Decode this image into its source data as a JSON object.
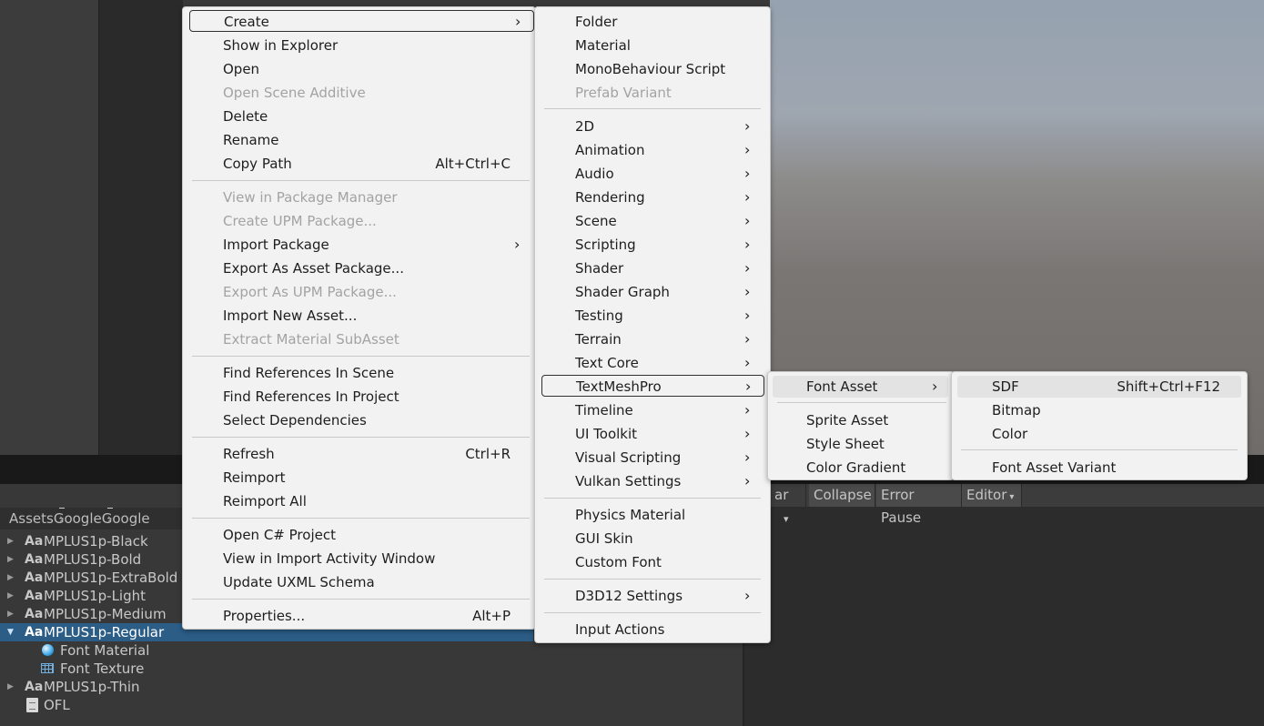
{
  "context_menu": {
    "items": [
      {
        "label": "Create",
        "arrow": "›"
      },
      {
        "label": "Show in Explorer"
      },
      {
        "label": "Open"
      },
      {
        "label": "Open Scene Additive",
        "disabled": true
      },
      {
        "label": "Delete"
      },
      {
        "label": "Rename"
      },
      {
        "label": "Copy Path",
        "shortcut": "Alt+Ctrl+C"
      },
      {
        "label": "View in Package Manager",
        "disabled": true
      },
      {
        "label": "Create UPM Package...",
        "disabled": true
      },
      {
        "label": "Import Package",
        "arrow": "›"
      },
      {
        "label": "Export As Asset Package..."
      },
      {
        "label": "Export As UPM Package...",
        "disabled": true
      },
      {
        "label": "Import New Asset..."
      },
      {
        "label": "Extract Material SubAsset",
        "disabled": true
      },
      {
        "label": "Find References In Scene"
      },
      {
        "label": "Find References In Project"
      },
      {
        "label": "Select Dependencies"
      },
      {
        "label": "Refresh",
        "shortcut": "Ctrl+R"
      },
      {
        "label": "Reimport"
      },
      {
        "label": "Reimport All"
      },
      {
        "label": "Open C# Project"
      },
      {
        "label": "View in Import Activity Window"
      },
      {
        "label": "Update UXML Schema"
      },
      {
        "label": "Properties...",
        "shortcut": "Alt+P"
      }
    ]
  },
  "create_submenu": {
    "items": [
      {
        "label": "Folder"
      },
      {
        "label": "Material"
      },
      {
        "label": "MonoBehaviour Script"
      },
      {
        "label": "Prefab Variant",
        "disabled": true
      },
      {
        "label": "2D",
        "arrow": "›"
      },
      {
        "label": "Animation",
        "arrow": "›"
      },
      {
        "label": "Audio",
        "arrow": "›"
      },
      {
        "label": "Rendering",
        "arrow": "›"
      },
      {
        "label": "Scene",
        "arrow": "›"
      },
      {
        "label": "Scripting",
        "arrow": "›"
      },
      {
        "label": "Shader",
        "arrow": "›"
      },
      {
        "label": "Shader Graph",
        "arrow": "›"
      },
      {
        "label": "Testing",
        "arrow": "›"
      },
      {
        "label": "Terrain",
        "arrow": "›"
      },
      {
        "label": "Text Core",
        "arrow": "›"
      },
      {
        "label": "TextMeshPro",
        "arrow": "›"
      },
      {
        "label": "Timeline",
        "arrow": "›"
      },
      {
        "label": "UI Toolkit",
        "arrow": "›"
      },
      {
        "label": "Visual Scripting",
        "arrow": "›"
      },
      {
        "label": "Vulkan Settings",
        "arrow": "›"
      },
      {
        "label": "Physics Material"
      },
      {
        "label": "GUI Skin"
      },
      {
        "label": "Custom Font"
      },
      {
        "label": "D3D12 Settings",
        "arrow": "›"
      },
      {
        "label": "Input Actions"
      }
    ]
  },
  "textmeshpro_submenu": {
    "items": [
      {
        "label": "Font Asset",
        "arrow": "›"
      },
      {
        "label": "Sprite Asset"
      },
      {
        "label": "Style Sheet"
      },
      {
        "label": "Color Gradient"
      }
    ]
  },
  "font_asset_submenu": {
    "items": [
      {
        "label": "SDF",
        "shortcut": "Shift+Ctrl+F12"
      },
      {
        "label": "Bitmap"
      },
      {
        "label": "Color"
      },
      {
        "label": "Font Asset Variant"
      }
    ]
  },
  "project": {
    "breadcrumb": [
      "Assets",
      "Google",
      "Google"
    ],
    "breadcrumb_sep": "›",
    "aa_icon": "Aa",
    "fold_closed": "▶",
    "fold_open": "▼",
    "tree": [
      {
        "label": "MPLUS1p-Black"
      },
      {
        "label": "MPLUS1p-Bold"
      },
      {
        "label": "MPLUS1p-ExtraBold"
      },
      {
        "label": "MPLUS1p-Light"
      },
      {
        "label": "MPLUS1p-Medium"
      },
      {
        "label": "MPLUS1p-Regular",
        "selected": true
      },
      {
        "label": "Font Material",
        "icon": "material-sphere-icon"
      },
      {
        "label": "Font Texture",
        "icon": "texture-icon"
      },
      {
        "label": "MPLUS1p-Thin"
      },
      {
        "label": "OFL",
        "icon": "text-file-icon"
      }
    ]
  },
  "console": {
    "clear_partial": "ar",
    "clear_dropdown": "▾",
    "collapse": "Collapse",
    "error_pause": "Error Pause",
    "editor": "Editor",
    "editor_dropdown": "▾"
  }
}
